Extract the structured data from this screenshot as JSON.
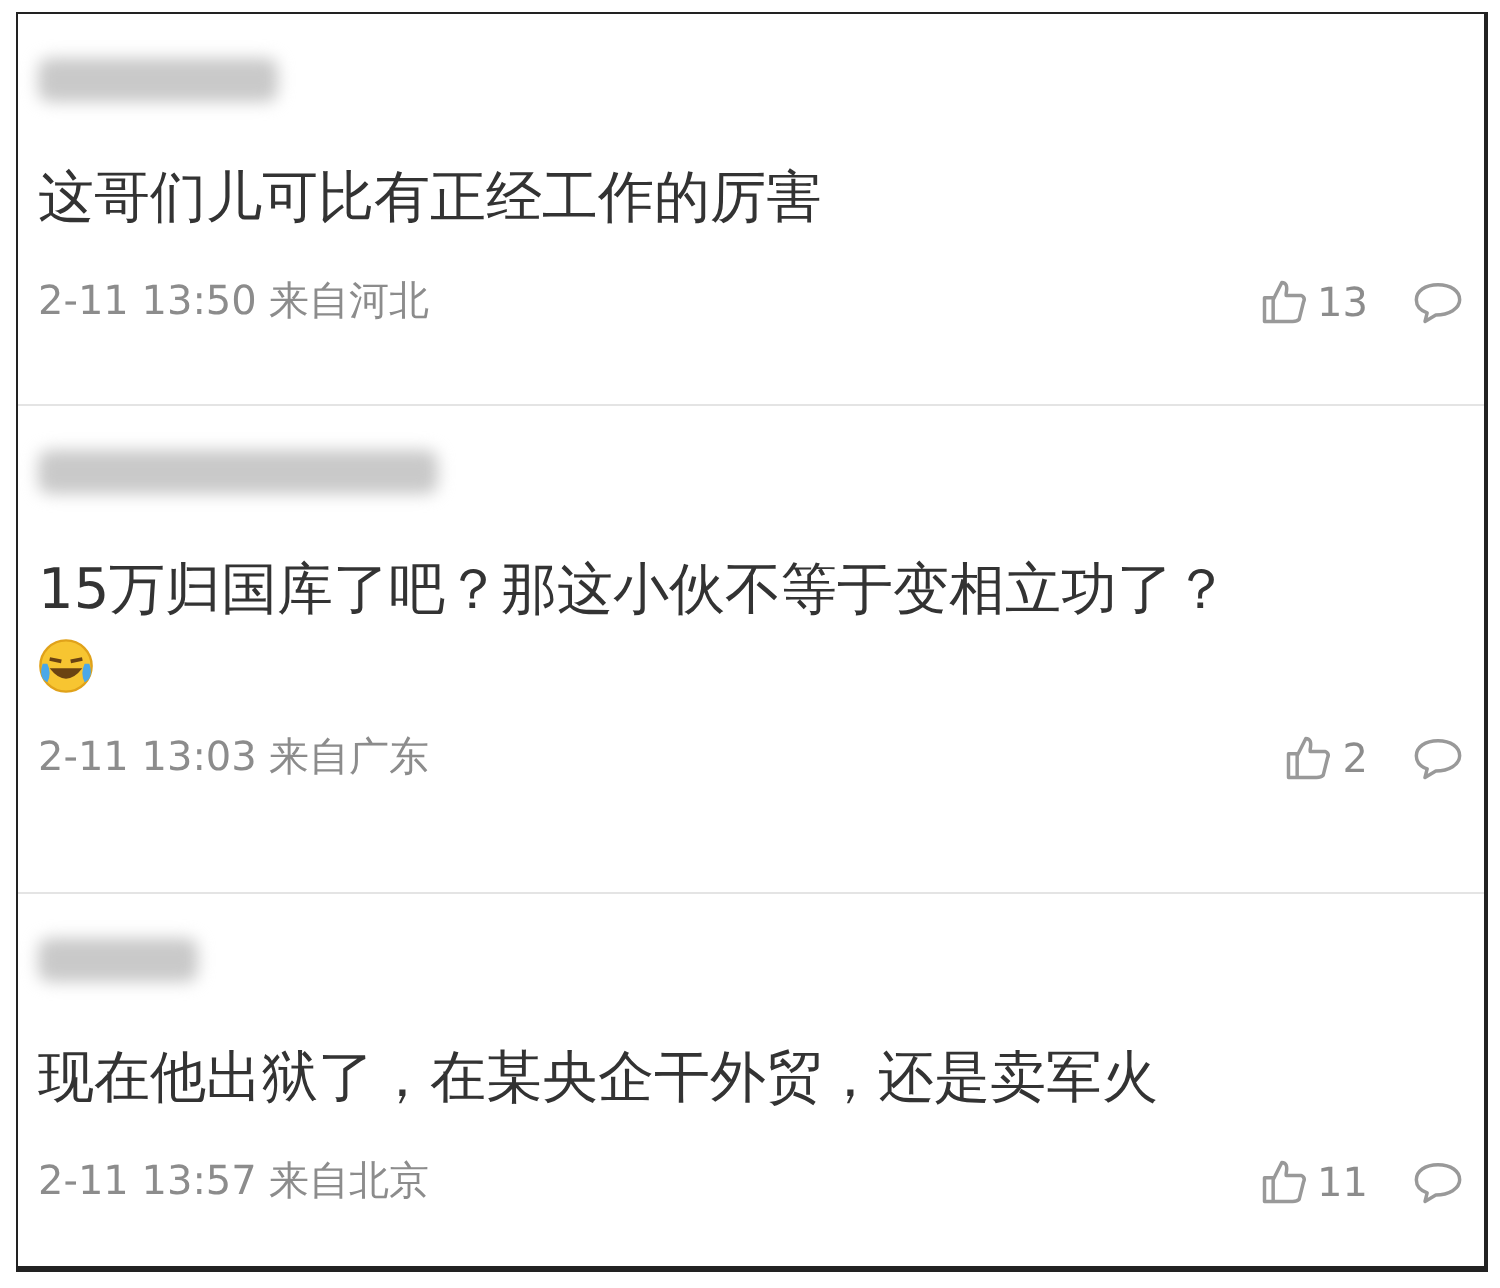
{
  "comments": [
    {
      "text": "这哥们儿可比有正经工作的厉害",
      "has_emoji": false,
      "time": "2-11 13:50",
      "location": "来自河北",
      "likes": "13"
    },
    {
      "text": "15万归国库了吧？那这小伙不等于变相立功了？",
      "has_emoji": true,
      "time": "2-11 13:03",
      "location": "来自广东",
      "likes": "2"
    },
    {
      "text": "现在他出狱了，在某央企干外贸，还是卖军火",
      "has_emoji": false,
      "time": "2-11 13:57",
      "location": "来自北京",
      "likes": "11"
    }
  ]
}
